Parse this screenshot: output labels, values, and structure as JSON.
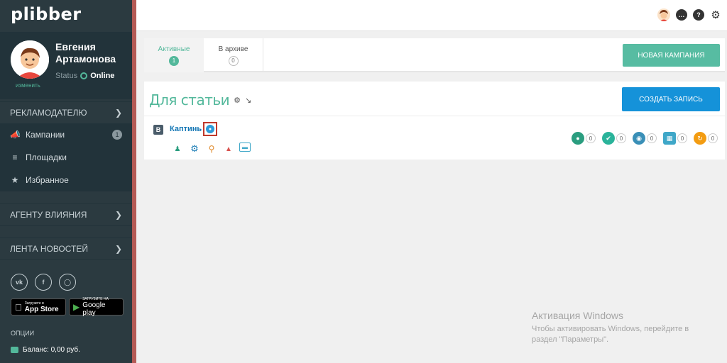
{
  "brand": {
    "logo": "plibber"
  },
  "profile": {
    "first_name": "Евгения",
    "last_name": "Артамонова",
    "change_label": "изменить",
    "status_label": "Status",
    "status_value": "Online"
  },
  "sidebar": {
    "advertiser_section": "РЕКЛАМОДАТЕЛЮ",
    "items": [
      {
        "label": "Кампании",
        "count": "1",
        "icon": "megaphone-icon"
      },
      {
        "label": "Площадки",
        "icon": "list-icon"
      },
      {
        "label": "Избранное",
        "icon": "star-icon"
      }
    ],
    "influence_section": "АГЕНТУ ВЛИЯНИЯ",
    "news_section": "ЛЕНТА НОВОСТЕЙ",
    "social": [
      "vk-icon",
      "facebook-icon",
      "instagram-icon"
    ],
    "app_store": {
      "small": "Загрузите в",
      "big": "App Store"
    },
    "google_play": {
      "small": "ЗАГРУЗИТЕ НА",
      "big": "Google play"
    },
    "options_label": "ОПЦИИ",
    "balance": "Баланс: 0,00 руб."
  },
  "tabs": {
    "active": {
      "label": "Активные",
      "count": "1"
    },
    "archive": {
      "label": "В архиве",
      "count": "0"
    }
  },
  "buttons": {
    "new_campaign": "НОВАЯ КАМПАНИЯ",
    "create_post": "СОЗДАТЬ ЗАПИСЬ"
  },
  "campaign": {
    "title": "Для статьи",
    "item": {
      "network_badge": "В",
      "title": "Каптинь",
      "stats": [
        {
          "icon": "user-icon",
          "value": "0",
          "color": "#2a9d7f"
        },
        {
          "icon": "check-icon",
          "value": "0",
          "color": "#2ab39a"
        },
        {
          "icon": "eye-icon",
          "value": "0",
          "color": "#3a8fb7"
        },
        {
          "icon": "calendar-icon",
          "value": "0",
          "color": "#3fa7c8"
        },
        {
          "icon": "refresh-icon",
          "value": "0",
          "color": "#f39c12"
        }
      ]
    }
  },
  "watermark": {
    "title": "Активация Windows",
    "text": "Чтобы активировать Windows, перейдите в раздел \"Параметры\"."
  }
}
